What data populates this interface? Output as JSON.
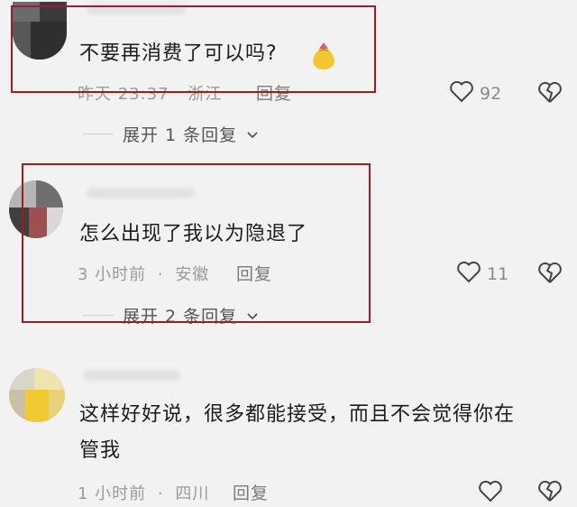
{
  "comments": [
    {
      "text": "不要再消费了可以吗?",
      "time": "昨天 23:37",
      "location": "浙江",
      "reply_label": "回复",
      "likes": "92",
      "expand_label": "展开 1 条回复"
    },
    {
      "text": "怎么出现了我以为隐退了",
      "time": "3 小时前",
      "location": "安徽",
      "reply_label": "回复",
      "likes": "11",
      "expand_label": "展开 2 条回复"
    },
    {
      "text_line1": "这样好好说，很多都能接受，而且不会觉得你在",
      "text_line2": "管我",
      "time": "1 小时前",
      "location": "四川",
      "reply_label": "回复",
      "likes": ""
    }
  ],
  "separator": "·",
  "colors": {
    "highlight_box": "#9e1c24",
    "meta_text": "#9a9a9a"
  }
}
